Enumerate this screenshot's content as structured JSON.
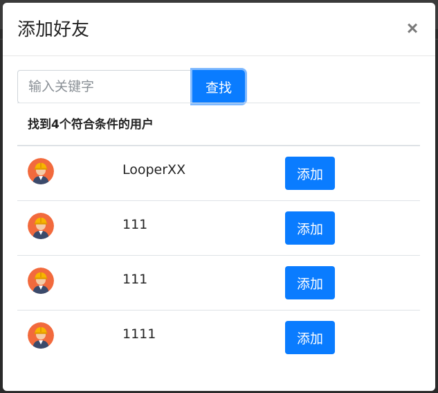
{
  "modal": {
    "title": "添加好友",
    "close_label": "×"
  },
  "search": {
    "placeholder": "输入关键字",
    "value": "",
    "button_label": "查找"
  },
  "results": {
    "header": "找到4个符合条件的用户",
    "add_label": "添加",
    "users": [
      {
        "name": "LooperXX",
        "avatar_icon": "worker-avatar-icon"
      },
      {
        "name": "111",
        "avatar_icon": "worker-avatar-icon"
      },
      {
        "name": "111",
        "avatar_icon": "worker-avatar-icon"
      },
      {
        "name": "1111",
        "avatar_icon": "worker-avatar-icon"
      }
    ]
  },
  "colors": {
    "primary": "#0a7cff",
    "avatar_bg": "#f26a3d",
    "helmet": "#f7b500"
  }
}
